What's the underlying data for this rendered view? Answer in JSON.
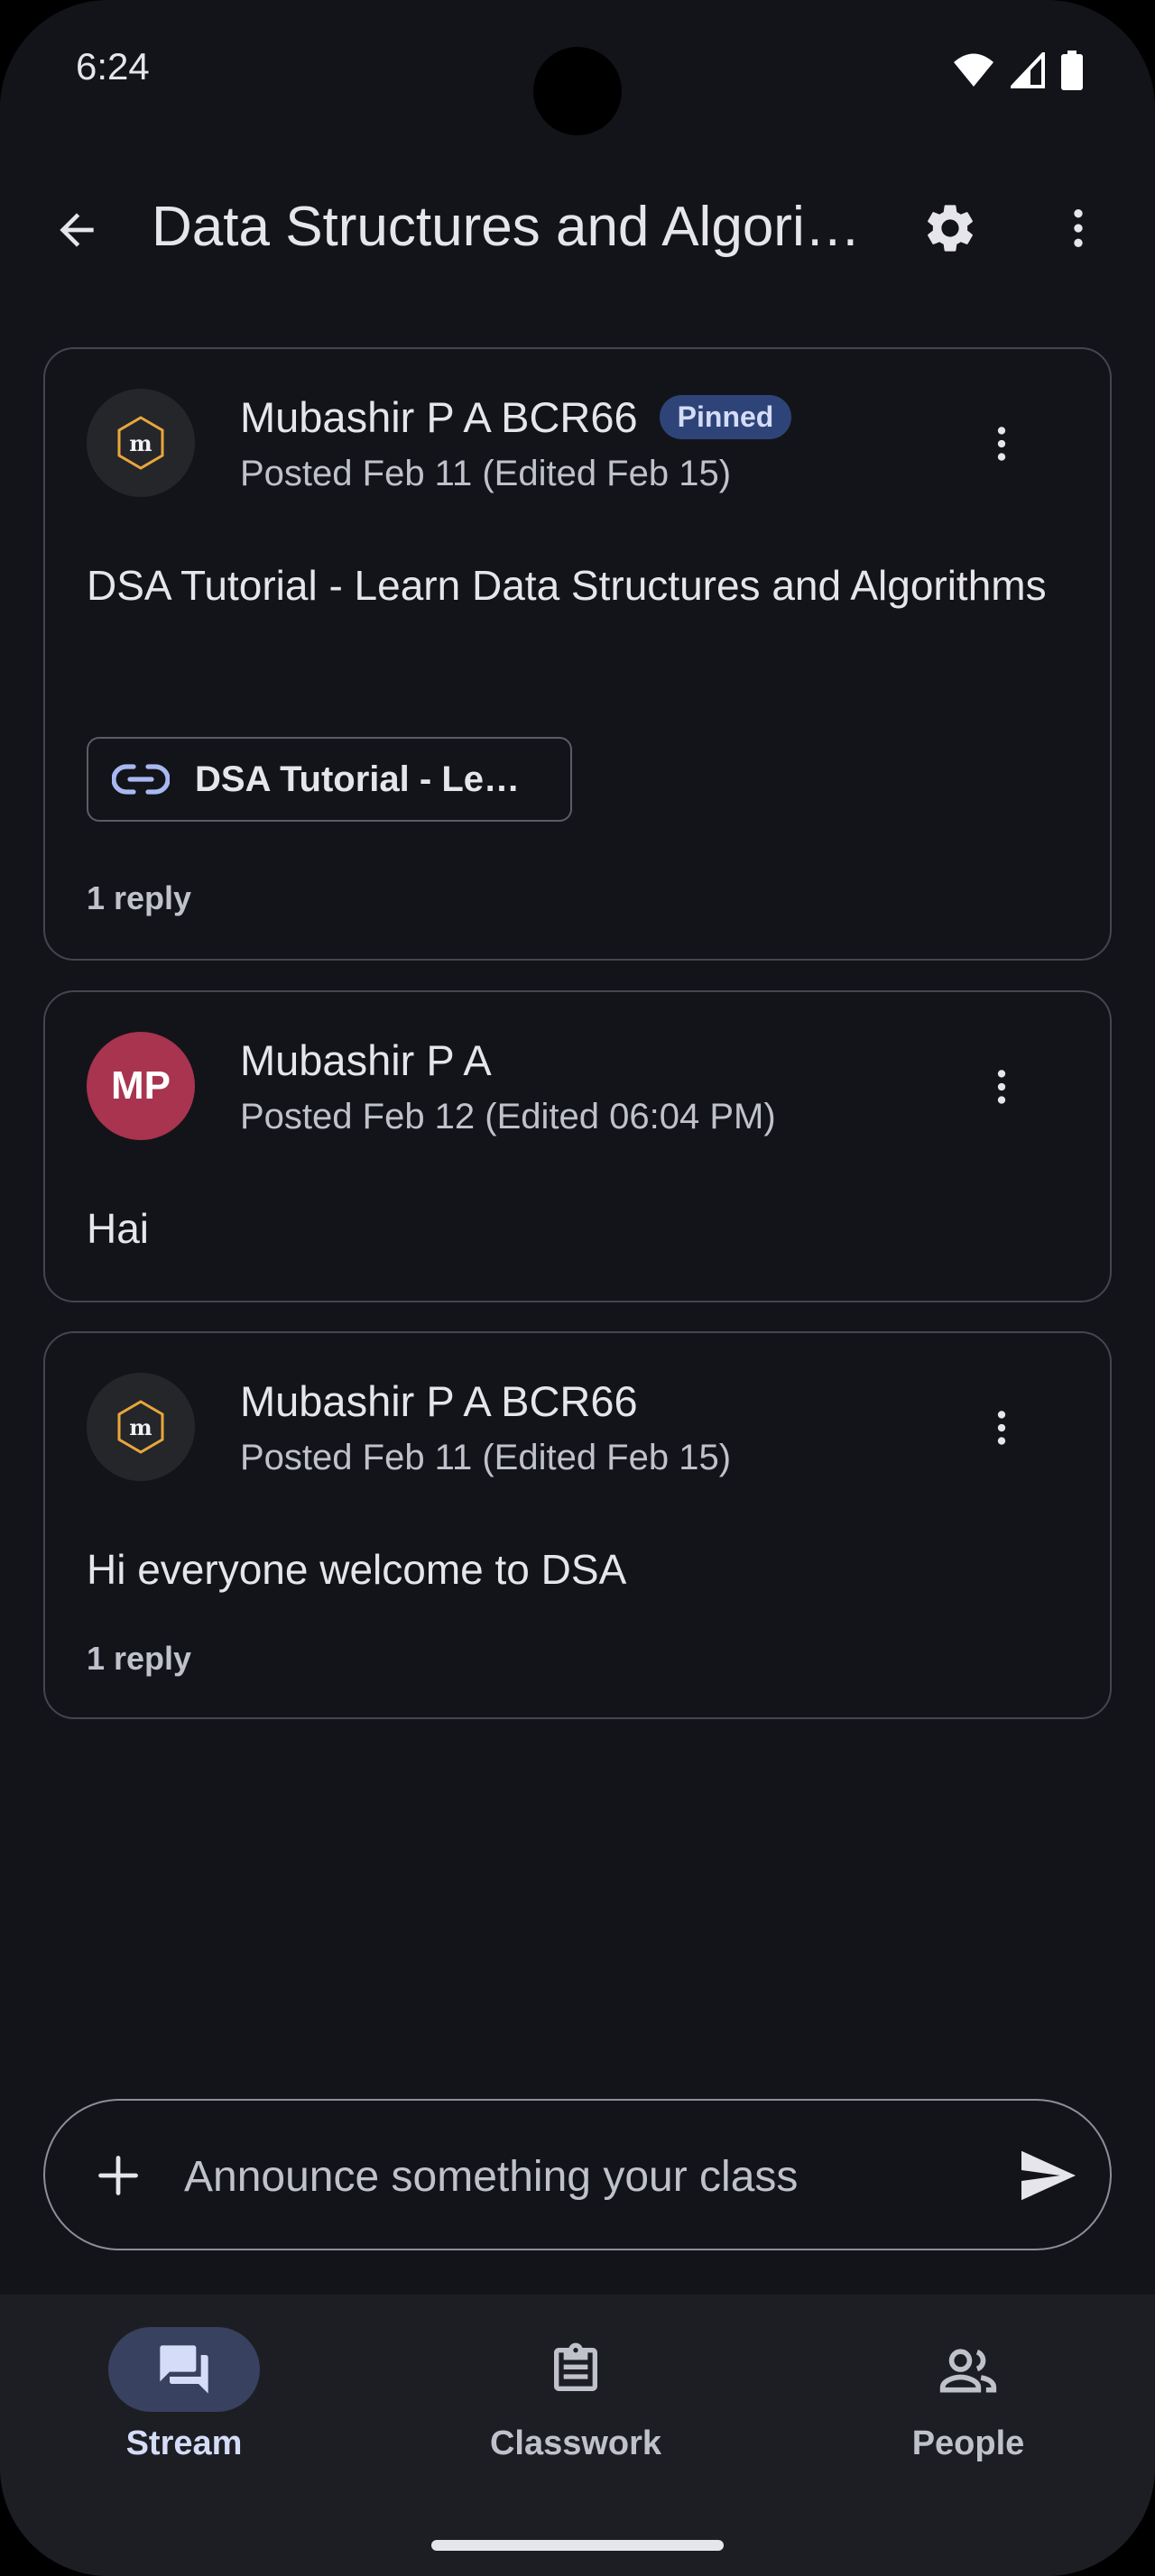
{
  "status_bar": {
    "time": "6:24"
  },
  "app_bar": {
    "title": "Data Structures and Algorithms"
  },
  "posts": [
    {
      "author": "Mubashir P A BCR66",
      "badge": "Pinned",
      "posted": "Posted Feb 11 (Edited Feb 15)",
      "text": "DSA Tutorial - Learn Data Structures and Algorithms",
      "link_label": "DSA Tutorial - Learn Data Structures and Algorithms",
      "replies": "1 reply",
      "avatar_icon": "logo-m-icon"
    },
    {
      "author": "Mubashir P A",
      "posted": "Posted Feb 12 (Edited 06:04 PM)",
      "text": "Hai",
      "avatar_initials": "MP",
      "avatar_color": "#a8344f"
    },
    {
      "author": "Mubashir P A BCR66",
      "posted": "Posted Feb 11 (Edited Feb 15)",
      "text": "Hi everyone welcome to DSA",
      "replies": "1 reply",
      "avatar_icon": "logo-m-icon"
    }
  ],
  "compose": {
    "placeholder": "Announce something your class"
  },
  "bottom_nav": {
    "items": [
      {
        "label": "Stream",
        "icon": "stream-icon",
        "active": true
      },
      {
        "label": "Classwork",
        "icon": "classwork-icon",
        "active": false
      },
      {
        "label": "People",
        "icon": "people-icon",
        "active": false
      }
    ]
  },
  "colors": {
    "background": "#131419",
    "accent_pill": "#384160",
    "pinned_badge": "#2e4478",
    "link_icon": "#a8b8f0"
  }
}
